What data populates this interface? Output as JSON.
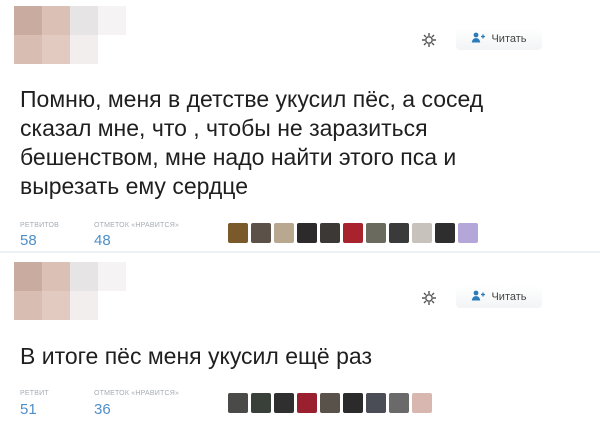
{
  "tweets": [
    {
      "follow_label": "Читать",
      "text": "Помню, меня в детстве укусил пёс, а сосед\nсказал мне, что , чтобы не заразиться\nбешенством, мне надо найти этого пса и\nвырезать ему сердце",
      "retweets_label": "РЕТВИТОВ",
      "retweets_value": "58",
      "likes_label": "ОТМЕТОК «НРАВИТСЯ»",
      "likes_value": "48",
      "likers": [
        "#7a5a2a",
        "#5b5148",
        "#b8a890",
        "#2c2a2a",
        "#3b3836",
        "#a8232d",
        "#6b6a5e",
        "#3a3a3a",
        "#c8c2bc",
        "#2e2e2e",
        "#b5a6d9"
      ]
    },
    {
      "follow_label": "Читать",
      "text": "В итоге пёс меня укусил ещё раз",
      "retweets_label": "РЕТВИТ",
      "retweets_value": "51",
      "likes_label": "ОТМЕТОК «НРАВИТСЯ»",
      "likes_value": "36",
      "likers": [
        "#4a4a48",
        "#39403a",
        "#2f2f2f",
        "#9a2030",
        "#58524a",
        "#2b2b2b",
        "#4a4d55",
        "#6a6a6a",
        "#d7b7b0"
      ]
    }
  ],
  "avatar_colors": [
    "#c9aba0",
    "#dbc0b6",
    "#e7e4e5",
    "#f5f3f4",
    "#d7bdb2",
    "#e2cac0",
    "#f2eeee",
    "#ffffff"
  ]
}
